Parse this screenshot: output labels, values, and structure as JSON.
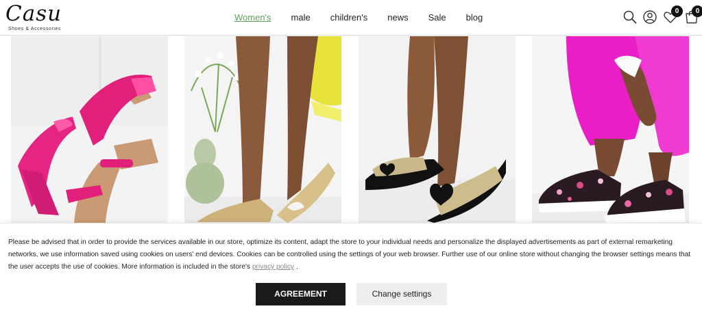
{
  "logo": {
    "word": "Casu",
    "tagline": "Shoes & Accessories"
  },
  "nav": [
    {
      "label": "Women's",
      "active": true
    },
    {
      "label": "male"
    },
    {
      "label": "children's"
    },
    {
      "label": "news"
    },
    {
      "label": "Sale"
    },
    {
      "label": "blog"
    }
  ],
  "header_icons": {
    "search": "search-icon",
    "account": "user-icon",
    "wishlist": "heart-icon",
    "wishlist_count": "0",
    "cart": "cart-icon",
    "cart_count": "0"
  },
  "products": [
    {
      "image": "pink-wedge-sandals"
    },
    {
      "image": "gold-slingback-flats"
    },
    {
      "image": "gold-heart-slides"
    },
    {
      "image": "floral-platform-sneakers"
    }
  ],
  "cookie": {
    "text_before_link": "Please be advised that in order to provide the services available in our store, optimize its content, adapt the store to your individual needs and personalize the displayed advertisements as part of external remarketing networks, we use information saved using cookies on users' end devices. Cookies can be controlled using the settings of your web browser. Further use of our online store without changing the browser settings means that the user accepts the use of cookies. More information is included in the store's",
    "link_text": "privacy policy",
    "text_after_link": ".",
    "agree_label": "AGREEMENT",
    "settings_label": "Change settings"
  },
  "colors": {
    "accent_nav": "#5fa05f",
    "agree_button": "#1a1a1a",
    "settings_button": "#eeeeee"
  }
}
